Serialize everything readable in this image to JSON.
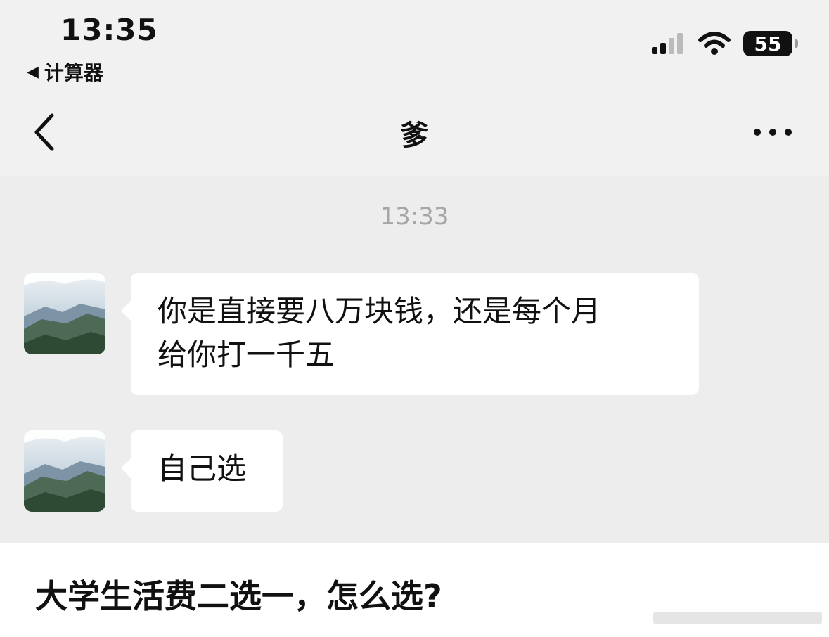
{
  "status_bar": {
    "time": "13:35",
    "back_app_arrow": "◀",
    "back_app_label": "计算器",
    "battery": "55",
    "icons": [
      "cellular-signal-icon",
      "wifi-icon",
      "battery-icon"
    ]
  },
  "nav": {
    "title": "爹",
    "back_icon": "chevron-left-icon",
    "more_icon": "more-dots-icon"
  },
  "chat": {
    "timestamp": "13:33",
    "messages": [
      {
        "sender": "爹",
        "line1": "你是直接要八万块钱，还是每个月",
        "line2": "给你打一千五"
      },
      {
        "sender": "爹",
        "line1": "自己选"
      }
    ]
  },
  "caption": "大学生活费二选一，怎么选?",
  "colors": {
    "chat_background": "#ededed",
    "bubble": "#ffffff",
    "timestamp_text": "#a6a6a6"
  }
}
